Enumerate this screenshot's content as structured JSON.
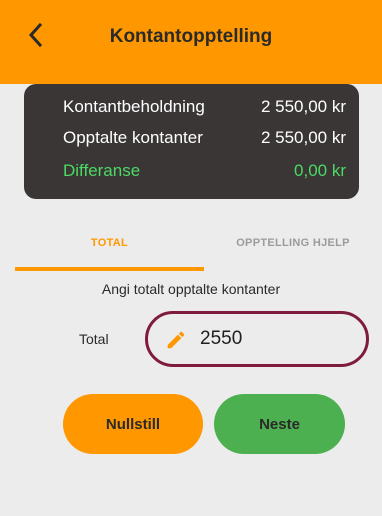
{
  "header": {
    "title": "Kontantopptelling",
    "back_icon": "chevron-left-icon"
  },
  "summary": {
    "rows": [
      {
        "label": "Kontantbeholdning",
        "value": "2 550,00 kr"
      },
      {
        "label": "Opptalte kontanter",
        "value": "2 550,00 kr"
      },
      {
        "label": "Differanse",
        "value": "0,00 kr"
      }
    ],
    "difference_color": "#4cd964"
  },
  "tabs": [
    {
      "label": "TOTAL",
      "active": true
    },
    {
      "label": "OPPTELLING HJELP",
      "active": false
    }
  ],
  "form": {
    "instruction": "Angi totalt opptalte kontanter",
    "total_label": "Total",
    "total_value": "2550",
    "field_icon": "pencil-icon"
  },
  "buttons": {
    "reset_label": "Nullstill",
    "next_label": "Neste"
  },
  "colors": {
    "accent": "#ff9800",
    "success": "#4caf50",
    "highlight_border": "#7e1b3f",
    "card_bg": "#3a3636"
  }
}
